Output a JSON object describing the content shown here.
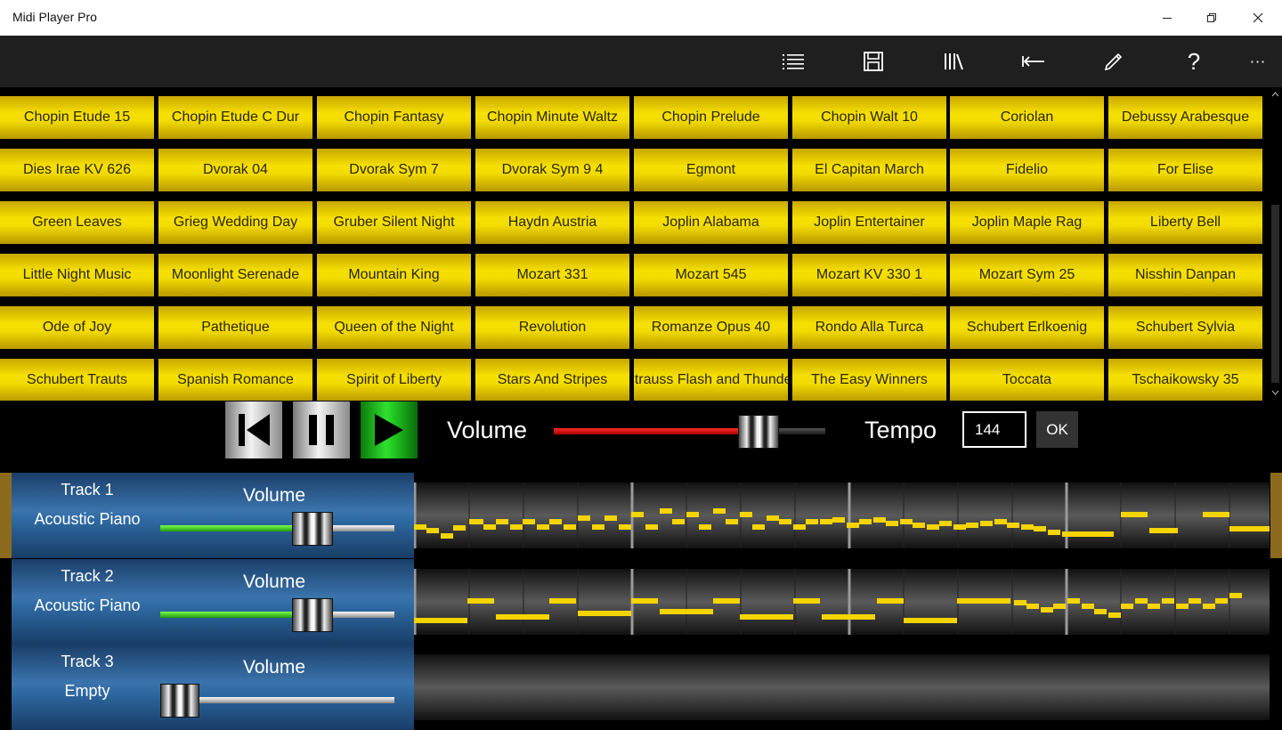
{
  "window": {
    "title": "Midi Player Pro",
    "controls": [
      "minimize-icon",
      "restore-icon",
      "close-icon"
    ]
  },
  "toolbar": {
    "icons": [
      "list-icon",
      "save-icon",
      "library-icon",
      "back-arrow-icon",
      "pencil-icon",
      "help-icon",
      "more-icon"
    ],
    "help_glyph": "?",
    "more_glyph": "···"
  },
  "songs": [
    "Chopin Etude 15",
    "Chopin Etude C Dur",
    "Chopin Fantasy",
    "Chopin Minute Waltz",
    "Chopin Prelude",
    "Chopin Walt 10",
    "Coriolan",
    "Debussy Arabesque",
    "Dies Irae KV 626",
    "Dvorak 04",
    "Dvorak Sym 7",
    "Dvorak Sym 9 4",
    "Egmont",
    "El Capitan March",
    "Fidelio",
    "For Elise",
    "Green Leaves",
    "Grieg Wedding Day",
    "Gruber Silent Night",
    "Haydn Austria",
    "Joplin Alabama",
    "Joplin Entertainer",
    "Joplin Maple Rag",
    "Liberty Bell",
    "Little Night Music",
    "Moonlight Serenade",
    "Mountain King",
    "Mozart 331",
    "Mozart 545",
    "Mozart KV 330 1",
    "Mozart Sym 25",
    "Nisshin Danpan",
    "Ode of Joy",
    "Pathetique",
    "Queen of the Night",
    "Revolution",
    "Romanze Opus 40",
    "Rondo Alla Turca",
    "Schubert Erlkoenig",
    "Schubert Sylvia",
    "Schubert Trauts",
    "Spanish Romance",
    "Spirit of  Liberty",
    "Stars And Stripes",
    "Strauss Flash and Thunder",
    "The Easy Winners",
    "Toccata",
    "Tschaikowsky 35"
  ],
  "transport": {
    "volume_label": "Volume",
    "volume_level": 0.8,
    "tempo_label": "Tempo",
    "tempo_value": "144",
    "ok_label": "OK",
    "colors": {
      "volume_fill": "#e00000",
      "play": "#22d022"
    }
  },
  "tracks": [
    {
      "name": "Track 1",
      "instrument": "Acoustic Piano",
      "volume_label": "Volume",
      "volume_level": 0.68,
      "selected": true
    },
    {
      "name": "Track 2",
      "instrument": "Acoustic Piano",
      "volume_label": "Volume",
      "volume_level": 0.68,
      "selected": false
    },
    {
      "name": "Track 3",
      "instrument": "Empty",
      "volume_label": "Volume",
      "volume_level": 0.0,
      "selected": false
    }
  ],
  "colors": {
    "song_button": "#f2dc00",
    "note": "#f5d400",
    "track_panel": "#3b74ad",
    "track_volume_fill": "#40d020"
  }
}
